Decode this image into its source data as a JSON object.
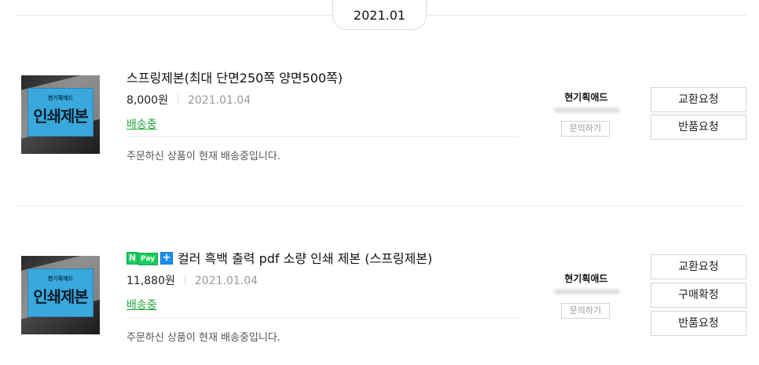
{
  "date_header": "2021.01",
  "orders": [
    {
      "thumb_brand": "현기획애드",
      "thumb_text": "인쇄제본",
      "npay": false,
      "title": "스프링제본(최대 단면250쪽 양면500쪽)",
      "price": "8,000원",
      "date": "2021.01.04",
      "status": "배송중",
      "description": "주문하신 상품이 현재 배송중입니다.",
      "seller": "현기획애드",
      "inquiry_label": "문의하기",
      "buttons": [
        "교환요청",
        "반품요청"
      ]
    },
    {
      "thumb_brand": "현기획애드",
      "thumb_text": "인쇄제본",
      "npay": true,
      "npay_n": "N",
      "npay_pay": "Pay",
      "npay_plus": "+",
      "title": "컬러 흑백 출력 pdf 소량 인쇄 제본 (스프링제본)",
      "price": "11,880원",
      "date": "2021.01.04",
      "status": "배송중",
      "description": "주문하신 상품이 현재 배송중입니다.",
      "seller": "현기획애드",
      "inquiry_label": "문의하기",
      "buttons": [
        "교환요청",
        "구매확정",
        "반품요청"
      ]
    }
  ]
}
